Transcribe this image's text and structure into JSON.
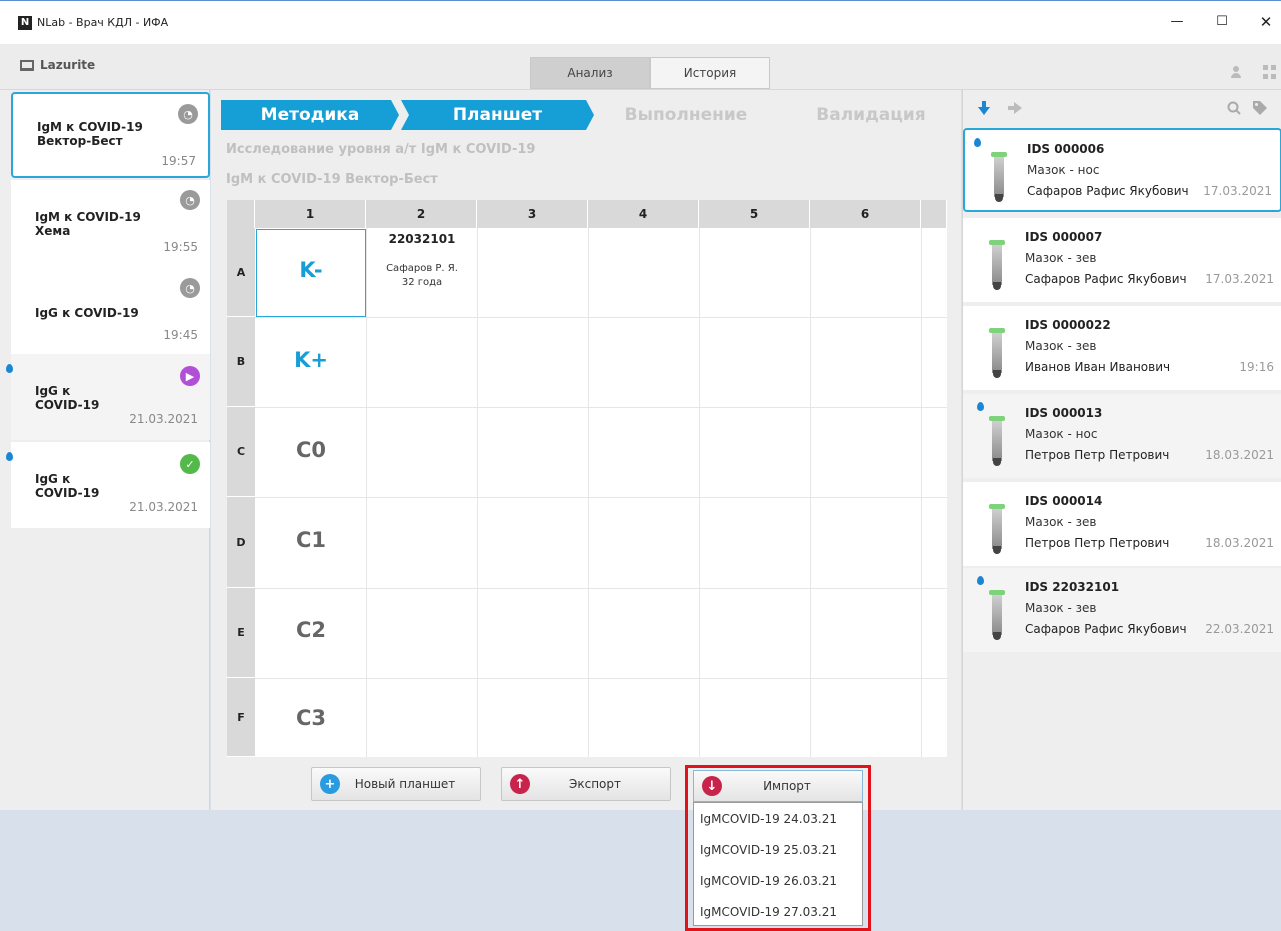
{
  "window": {
    "title": "NLab - Врач КДЛ - ИФА",
    "logo": "N",
    "controls": {
      "minimize": "—",
      "maximize": "☐",
      "close": "✕"
    }
  },
  "toolbar": {
    "brand": "Lazurite",
    "tabs": [
      {
        "label": "Анализ",
        "active": true
      },
      {
        "label": "История",
        "active": false
      }
    ]
  },
  "tasks": [
    {
      "title": "IgM к COVID-19\nВектор-Бест",
      "time": "19:57",
      "status": "clock",
      "has_drop": false,
      "selected": true
    },
    {
      "title": "IgM к COVID-19\nХема",
      "time": "19:55",
      "status": "clock",
      "has_drop": false,
      "selected": false
    },
    {
      "title": "IgG к COVID-19",
      "time": "19:45",
      "status": "clock",
      "has_drop": false,
      "selected": false
    },
    {
      "title": "IgG к\nCOVID-19",
      "time": "21.03.2021",
      "status": "play",
      "has_drop": true,
      "selected": false
    },
    {
      "title": "IgG к\nCOVID-19",
      "time": "21.03.2021",
      "status": "done",
      "has_drop": true,
      "selected": false
    }
  ],
  "steps": [
    {
      "label": "Методика",
      "state": "done"
    },
    {
      "label": "Планшет",
      "state": "done"
    },
    {
      "label": "Выполнение",
      "state": "todo"
    },
    {
      "label": "Валидация",
      "state": "todo"
    }
  ],
  "study": {
    "title": "Исследование уровня а/т IgM к COVID-19",
    "kit": "IgM к COVID-19 Вектор-Бест"
  },
  "plate": {
    "columns": [
      "1",
      "2",
      "3",
      "4",
      "5",
      "6"
    ],
    "rows": [
      "A",
      "B",
      "C",
      "D",
      "E",
      "F"
    ],
    "controls": [
      {
        "row": "A",
        "label": "K-",
        "style": "blue"
      },
      {
        "row": "B",
        "label": "K+",
        "style": "blue"
      },
      {
        "row": "C",
        "label": "C0",
        "style": "grey"
      },
      {
        "row": "D",
        "label": "C1",
        "style": "grey"
      },
      {
        "row": "E",
        "label": "C2",
        "style": "grey"
      },
      {
        "row": "F",
        "label": "C3",
        "style": "grey"
      }
    ],
    "sample": {
      "well": "A2",
      "id": "22032101",
      "name": "Сафаров Р. Я.",
      "age": "32 года"
    }
  },
  "buttons": {
    "new_plate": "Новый планшет",
    "export": "Экспорт",
    "import": "Импорт"
  },
  "import_menu": [
    "IgMCOVID-19 24.03.21",
    "IgMCOVID-19 25.03.21",
    "IgMCOVID-19 26.03.21",
    "IgMCOVID-19 27.03.21"
  ],
  "samples": [
    {
      "id": "IDS 000006",
      "type": "Мазок - нос",
      "patient": "Сафаров Рафис Якубович",
      "date": "17.03.2021",
      "has_drop": true,
      "selected": true
    },
    {
      "id": "IDS 000007",
      "type": "Мазок - зев",
      "patient": "Сафаров Рафис Якубович",
      "date": "17.03.2021",
      "has_drop": false,
      "selected": false
    },
    {
      "id": "IDS 0000022",
      "type": "Мазок - зев",
      "patient": "Иванов Иван Иванович",
      "date": "19:16",
      "has_drop": false,
      "selected": false
    },
    {
      "id": "IDS 000013",
      "type": "Мазок - нос",
      "patient": "Петров Петр Петрович",
      "date": "18.03.2021",
      "has_drop": true,
      "selected": false
    },
    {
      "id": "IDS 000014",
      "type": "Мазок - зев",
      "patient": "Петров Петр Петрович",
      "date": "18.03.2021",
      "has_drop": false,
      "selected": false
    },
    {
      "id": "IDS 22032101",
      "type": "Мазок - зев",
      "patient": "Сафаров Рафис Якубович",
      "date": "22.03.2021",
      "has_drop": true,
      "selected": false
    }
  ],
  "colors": {
    "accent": "#169ed6",
    "highlight": "#e0121a",
    "status_play": "#b14fd6",
    "status_done": "#54b94b"
  }
}
